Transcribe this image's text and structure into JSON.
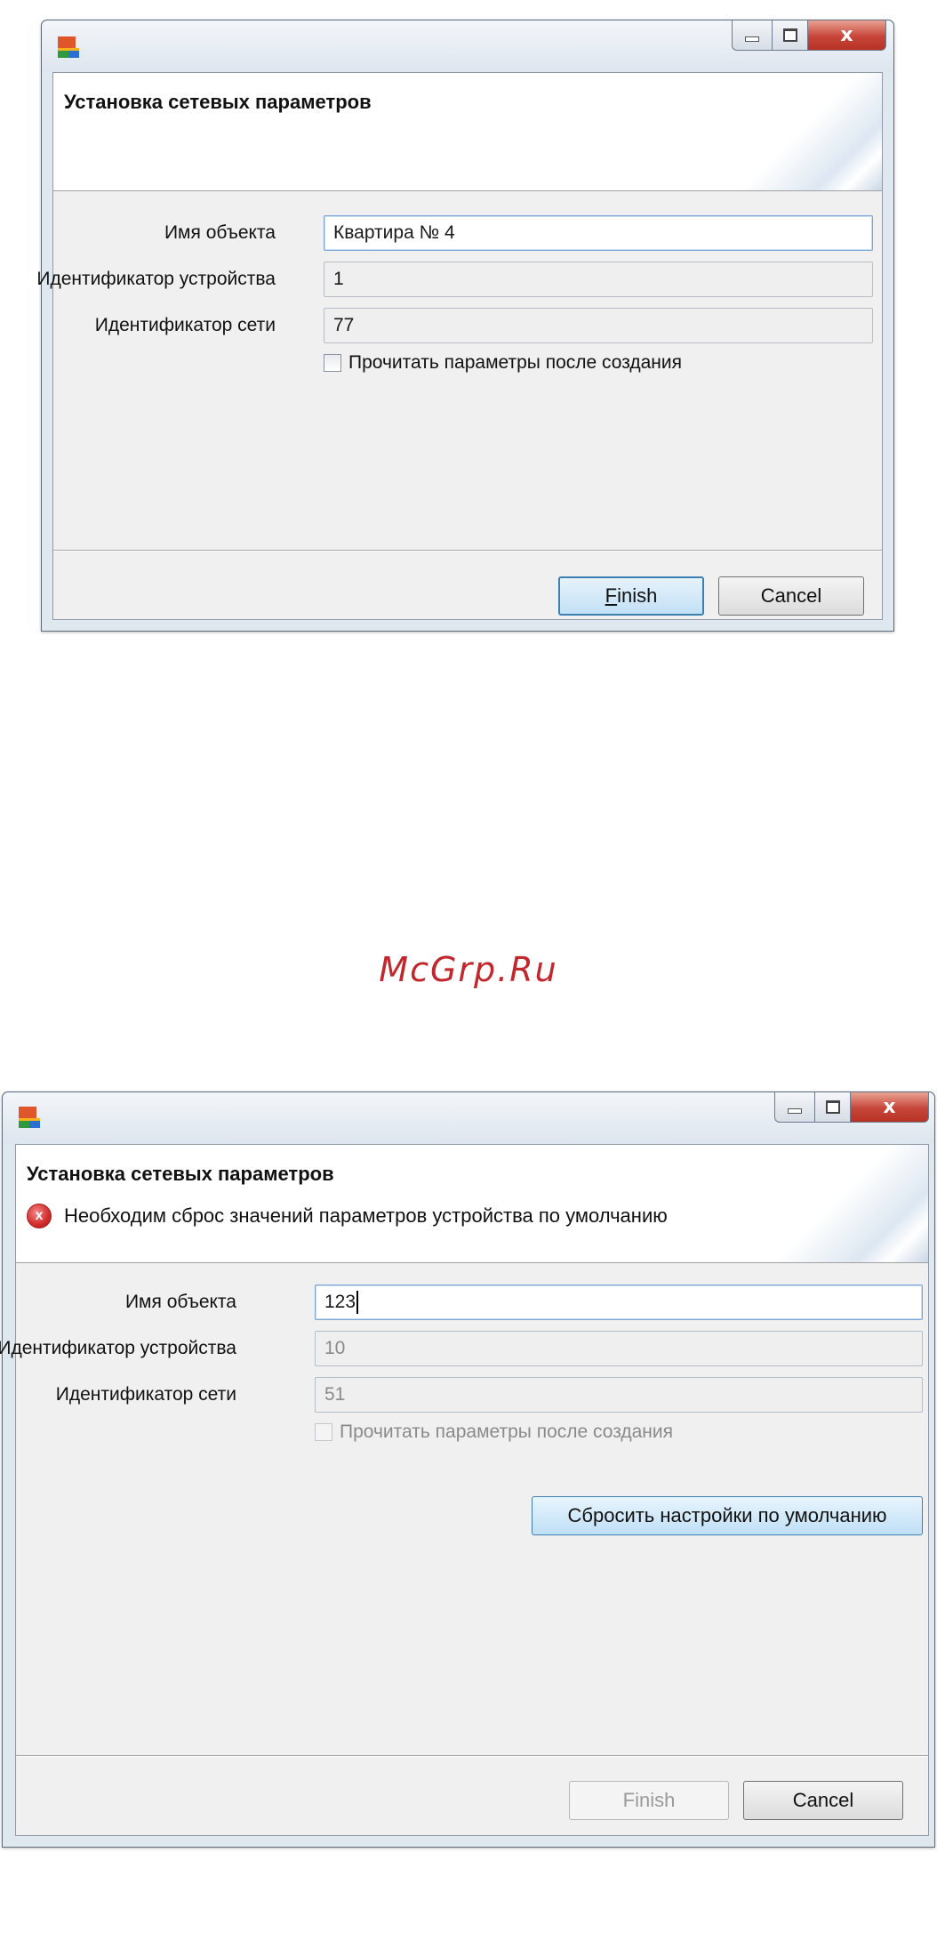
{
  "dialog1": {
    "header_title": "Установка сетевых параметров",
    "fields": [
      {
        "label": "Имя объекта",
        "value": "Квартира № 4"
      },
      {
        "label": "Идентификатор устройства",
        "value": "1"
      },
      {
        "label": "Идентификатор сети",
        "value": "77"
      }
    ],
    "checkbox_label": "Прочитать параметры после создания",
    "finish_mnemonic": "F",
    "finish_rest": "inish",
    "cancel_label": "Cancel"
  },
  "watermark": "McGrp.Ru",
  "dialog2": {
    "header_title": "Установка сетевых параметров",
    "header_message": "Необходим сброс значений параметров устройства по умолчанию",
    "error_icon": "x",
    "fields": [
      {
        "label": "Имя объекта",
        "value": "123"
      },
      {
        "label": "Идентификатор устройства",
        "value": "10"
      },
      {
        "label": "Идентификатор сети",
        "value": "51"
      }
    ],
    "checkbox_label": "Прочитать параметры после создания",
    "reset_label": "Сбросить настройки по умолчанию",
    "finish_label": "Finish",
    "cancel_label": "Cancel"
  },
  "window_controls": {
    "close_glyph": "x"
  },
  "colors": {
    "accent": "#3c7fb1",
    "error": "#d12a2a",
    "watermark": "#c1272d"
  }
}
